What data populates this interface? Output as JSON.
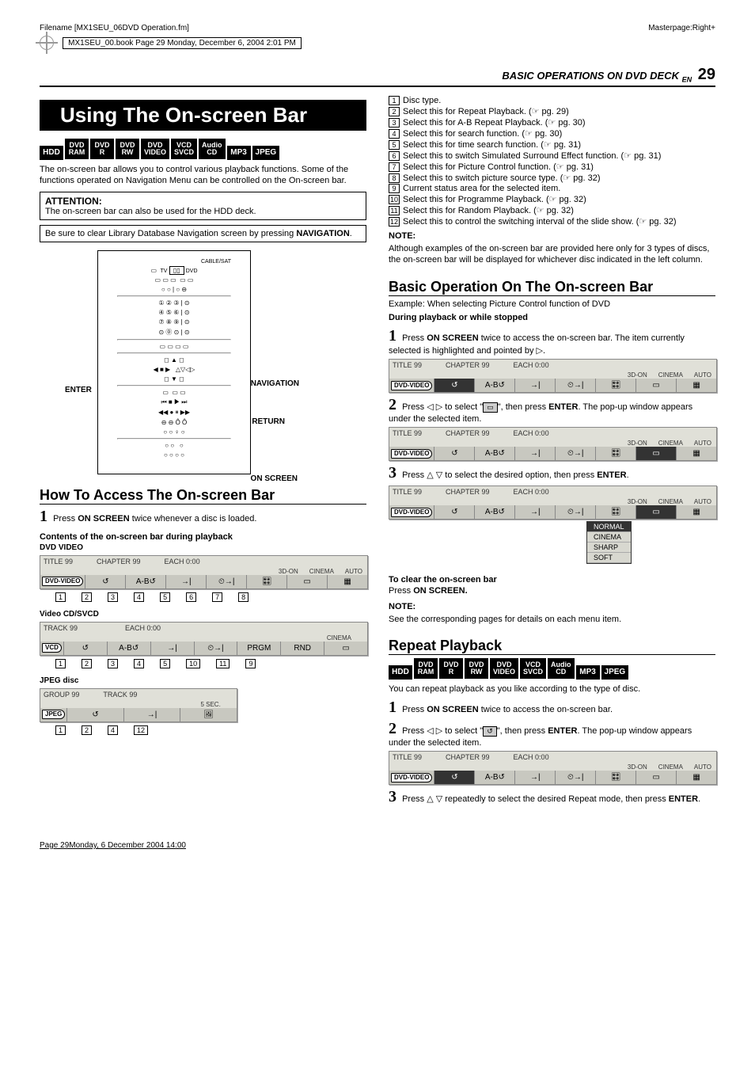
{
  "meta": {
    "filename": "Filename [MX1SEU_06DVD Operation.fm]",
    "bookline": "MX1SEU_00.book  Page 29  Monday, December 6, 2004  2:01 PM",
    "masterpage": "Masterpage:Right+"
  },
  "header": {
    "section": "BASIC OPERATIONS ON DVD DECK",
    "lang": "EN",
    "page": "29"
  },
  "title": "Using The On-screen Bar",
  "badges": [
    "HDD",
    "DVD RAM",
    "DVD R",
    "DVD RW",
    "DVD VIDEO",
    "VCD SVCD",
    "Audio CD",
    "MP3",
    "JPEG"
  ],
  "intro": "The on-screen bar allows you to control various playback functions. Some of the functions operated on Navigation Menu can be controlled on the On-screen bar.",
  "attention": {
    "title": "ATTENTION:",
    "text": "The on-screen bar can also be used for the HDD deck."
  },
  "tip": {
    "pre": "Be sure to clear Library Database Navigation screen by pressing ",
    "bold": "NAVIGATION",
    "post": "."
  },
  "remote_labels": {
    "enter": "ENTER",
    "navigation": "NAVIGATION",
    "return": "RETURN",
    "onscreen": "ON SCREEN",
    "top": "CABLE/SAT",
    "tv": "TV",
    "dvd": "DVD"
  },
  "howto": {
    "title": "How To Access The On-screen Bar",
    "step1_pre": "Press ",
    "step1_b": "ON SCREEN",
    "step1_post": " twice whenever a disc is loaded.",
    "contents_title": "Contents of the on-screen bar during playback",
    "dvd_video": "DVD VIDEO",
    "vcd_title": "Video CD/SVCD",
    "jpeg_title": "JPEG disc"
  },
  "bars": {
    "dvd": {
      "top": [
        "TITLE 99",
        "CHAPTER 99",
        "EACH 0:00"
      ],
      "right": [
        "3D-ON",
        "CINEMA",
        "AUTO"
      ],
      "disc": "DVD-VIDEO",
      "cells": [
        "↺",
        "A-B↺",
        "→|",
        "⏲→|",
        "🎛",
        "▭",
        "▦"
      ]
    },
    "vcd": {
      "top": [
        "TRACK 99",
        "",
        "EACH 0:00"
      ],
      "right": [
        "",
        "CINEMA",
        ""
      ],
      "disc": "VCD",
      "cells": [
        "↺",
        "A-B↺",
        "→|",
        "⏲→|",
        "PRGM",
        "RND",
        "▭"
      ]
    },
    "jpeg": {
      "top": [
        "GROUP 99",
        "TRACK 99",
        ""
      ],
      "right": [
        "",
        "5 SEC.",
        ""
      ],
      "disc": "JPEG",
      "cells": [
        "↺",
        "→|",
        "🖼"
      ]
    }
  },
  "legend_numbers": {
    "dvd": [
      "1",
      "2",
      "3",
      "4",
      "5",
      "6",
      "7",
      "8"
    ],
    "vcd": [
      "1",
      "2",
      "3",
      "4",
      "5",
      "10",
      "11",
      "9"
    ],
    "jpeg": [
      "1",
      "2",
      "4",
      "12"
    ]
  },
  "refs": [
    {
      "n": "1",
      "t": "Disc type."
    },
    {
      "n": "2",
      "t": "Select this for Repeat Playback. (☞ pg. 29)"
    },
    {
      "n": "3",
      "t": "Select this for A-B Repeat Playback. (☞ pg. 30)"
    },
    {
      "n": "4",
      "t": "Select this for search function. (☞ pg. 30)"
    },
    {
      "n": "5",
      "t": "Select this for time search function. (☞ pg. 31)"
    },
    {
      "n": "6",
      "t": "Select this to switch Simulated Surround Effect function. (☞ pg. 31)"
    },
    {
      "n": "7",
      "t": "Select this for Picture Control function. (☞ pg. 31)"
    },
    {
      "n": "8",
      "t": "Select this to switch picture source type. (☞ pg. 32)"
    },
    {
      "n": "9",
      "t": "Current status area for the selected item."
    },
    {
      "n": "10",
      "t": "Select this for Programme Playback. (☞ pg. 32)"
    },
    {
      "n": "11",
      "t": "Select this for Random Playback. (☞ pg. 32)"
    },
    {
      "n": "12",
      "t": "Select this to control the switching interval of the slide show. (☞ pg. 32)"
    }
  ],
  "note1": {
    "title": "NOTE:",
    "text": "Although examples of the on-screen bar are provided here only for 3 types of discs, the on-screen bar will be displayed for whichever disc indicated in the left column."
  },
  "basicop": {
    "title": "Basic Operation On The On-screen Bar",
    "example": "Example: When selecting Picture Control function of DVD",
    "during": "During playback or while stopped",
    "s1_a": "Press ",
    "s1_b": "ON SCREEN",
    "s1_c": " twice to access the on-screen bar. The item currently selected is highlighted and pointed by ▷.",
    "s2_a": "Press ◁ ▷ to select \"",
    "s2_icon": "▭",
    "s2_b": "\", then press ",
    "s2_c": "ENTER",
    "s2_d": ". The pop-up window appears under the selected item.",
    "s3_a": "Press △ ▽ to select the desired option, then press ",
    "s3_b": "ENTER",
    "s3_c": "."
  },
  "dropdown": [
    "NORMAL",
    "CINEMA",
    "SHARP",
    "SOFT"
  ],
  "clear": {
    "t1": "To clear the on-screen bar",
    "t2a": "Press ",
    "t2b": "ON SCREEN."
  },
  "note2": {
    "title": "NOTE:",
    "text": "See the corresponding pages for details on each menu item."
  },
  "repeat": {
    "title": "Repeat Playback",
    "intro": "You can repeat playback as you like according to the type of disc.",
    "s1_a": "Press ",
    "s1_b": "ON SCREEN",
    "s1_c": " twice to access the on-screen bar.",
    "s2_a": "Press ◁ ▷ to select \"",
    "s2_icon": "↺",
    "s2_b": "\", then press ",
    "s2_c": "ENTER",
    "s2_d": ". The pop-up window appears under the selected item.",
    "s3_a": "Press △ ▽ repeatedly to select the desired Repeat mode, then press ",
    "s3_b": "ENTER",
    "s3_c": "."
  },
  "footer": "Page 29Monday, 6 December 2004  14:00"
}
